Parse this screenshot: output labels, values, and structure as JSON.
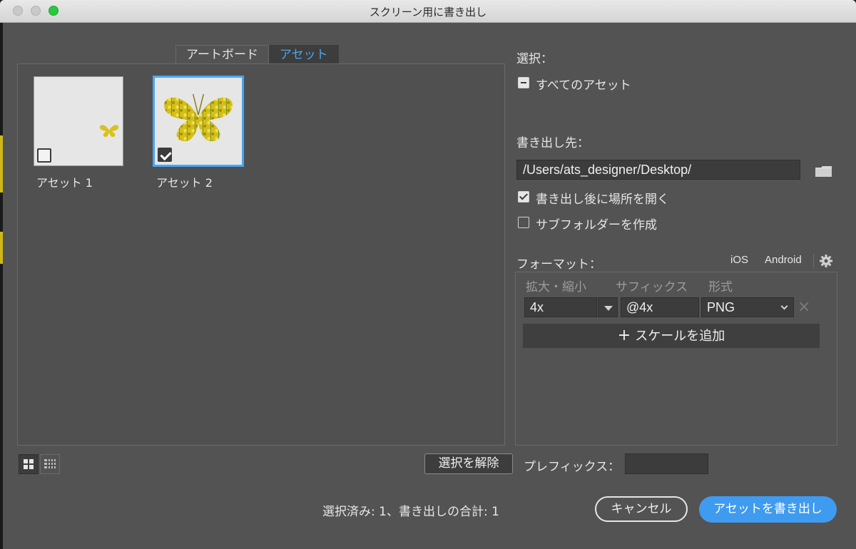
{
  "window": {
    "title": "スクリーン用に書き出し"
  },
  "tabs": [
    {
      "label": "アートボード",
      "active": false
    },
    {
      "label": "アセット",
      "active": true
    }
  ],
  "assets": [
    {
      "label": "アセット 1",
      "checked": false,
      "selected": false
    },
    {
      "label": "アセット 2",
      "checked": true,
      "selected": true
    }
  ],
  "selection": {
    "label": "選択：",
    "all_assets_label": "すべてのアセット",
    "all_assets_state": "mixed"
  },
  "destination": {
    "label": "書き出し先：",
    "path": "/Users/ats_designer/Desktop/",
    "open_after_label": "書き出し後に場所を開く",
    "open_after_checked": true,
    "subfolder_label": "サブフォルダーを作成",
    "subfolder_checked": false
  },
  "format": {
    "label": "フォーマット：",
    "ios_label": "iOS",
    "android_label": "Android",
    "columns": {
      "scale": "拡大・縮小",
      "suffix": "サフィックス",
      "type": "形式"
    },
    "rows": [
      {
        "scale": "4x",
        "suffix": "@4x",
        "type": "PNG"
      }
    ],
    "add_scale_label": "スケールを追加",
    "remove_label": "×",
    "plus_label": "+"
  },
  "footer": {
    "deselect_label": "選択を解除",
    "prefix_label": "プレフィックス：",
    "prefix_value": "",
    "status": "選択済み: 1、書き出しの合計: 1",
    "cancel_label": "キャンセル",
    "export_label": "アセットを書き出し"
  },
  "colors": {
    "accent": "#4aa6f3",
    "primary_button": "#3f9bf0",
    "panel": "#535353",
    "field": "#3c3c3c",
    "butterfly": "#d8c21c"
  }
}
